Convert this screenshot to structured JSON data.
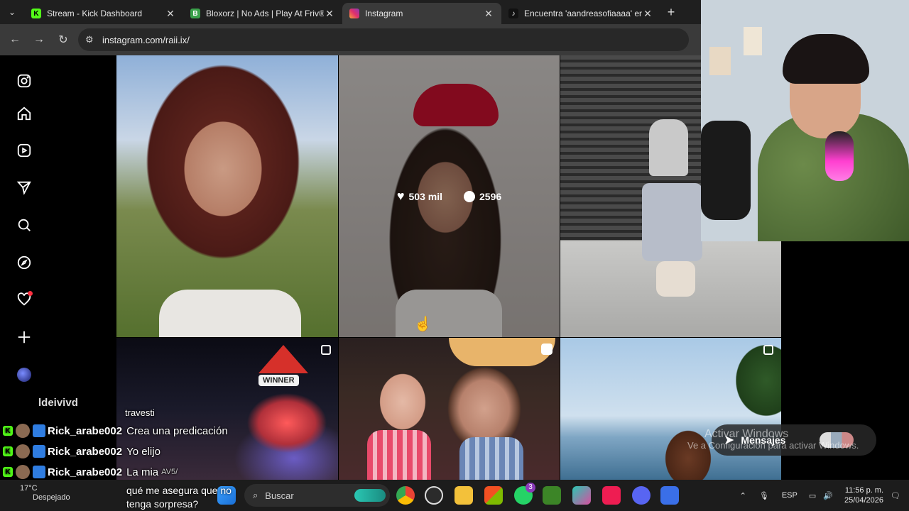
{
  "browser": {
    "tabs": [
      {
        "title": "Stream - Kick Dashboard",
        "icon": "kick-icon",
        "active": false
      },
      {
        "title": "Bloxorz | No Ads | Play At Friv®",
        "icon": "friv-icon",
        "active": false
      },
      {
        "title": "Instagram",
        "icon": "instagram-icon",
        "active": true
      },
      {
        "title": "Encuentra 'aandreasofiaaaa' en",
        "icon": "tiktok-icon",
        "active": false
      }
    ],
    "url": "instagram.com/raii.ix/"
  },
  "post_overlay": {
    "likes": "503 mil",
    "comments": "2596"
  },
  "photo_captions": {
    "winner_sign": "WINNER",
    "caption_overlay": "travesti",
    "sticker": "AV5/"
  },
  "messages": {
    "label": "Mensajes"
  },
  "watermark": {
    "line1": "Activar Windows",
    "line2": "Ve a Configuración para activar Windows."
  },
  "chat": {
    "partial_top": "ldeivivd",
    "lines": [
      {
        "user": "Rick_arabe002",
        "message": "Crea una predicación"
      },
      {
        "user": "Rick_arabe002",
        "message": "Yo elijo"
      },
      {
        "user": "Rick_arabe002",
        "message": "La mia"
      },
      {
        "user": "ldeivivd",
        "message": ""
      }
    ]
  },
  "stream_question": {
    "line1": "qué me asegura que no",
    "line2": "tenga sorpresa?"
  },
  "taskbar": {
    "search_placeholder": "Buscar",
    "weather_temp": "17°C",
    "weather_desc": "Despejado",
    "language": "ESP",
    "time": "11:56 p. m.",
    "date": "25/04/2026",
    "whatsapp_badge": "3"
  }
}
